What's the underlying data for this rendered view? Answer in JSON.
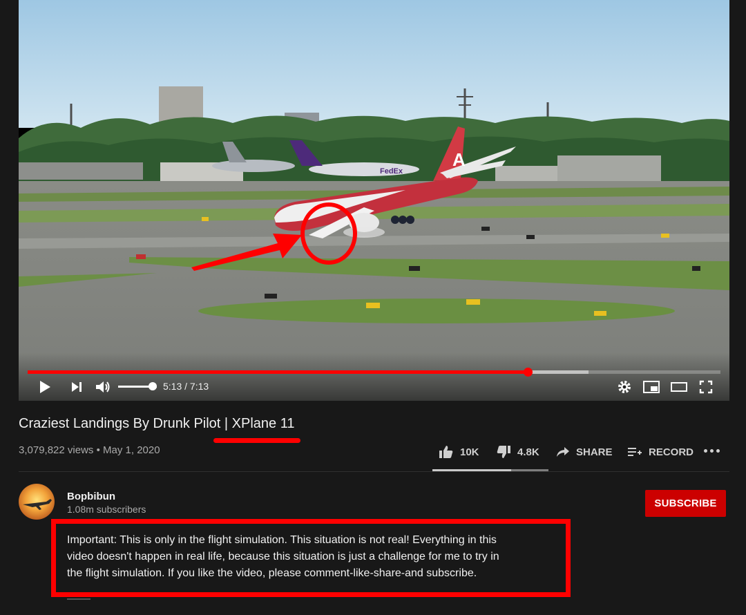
{
  "player": {
    "time_display": "5:13 / 7:13",
    "played_fraction": 0.722,
    "buffered_fraction": 0.81,
    "volume_fraction": 1.0,
    "accent_color": "#ff0000",
    "icons": [
      "play-icon",
      "next-icon",
      "volume-icon",
      "settings-icon",
      "miniplayer-icon",
      "theater-icon",
      "fullscreen-icon"
    ],
    "aircraft_tail_logo": "A",
    "background_aircraft_livery": "FedEx"
  },
  "video": {
    "title": "Craziest Landings By Drunk Pilot | XPlane 11",
    "views": "3,079,822 views",
    "separator": "•",
    "date": "May 1, 2020"
  },
  "actions": {
    "like_count": "10K",
    "dislike_count": "4.8K",
    "share_label": "SHARE",
    "record_label": "RECORD",
    "like_ratio": 0.676
  },
  "channel": {
    "name": "Bopbibun",
    "subscribers": "1.08m subscribers",
    "subscribe_label": "SUBSCRIBE",
    "subscribe_color": "#cc0000"
  },
  "description": {
    "lines": [
      "Important: This is only in the flight simulation. This situation is not real! Everything in this",
      "video doesn't happen in real life, because this situation is just a challenge for me to try in",
      "the flight simulation. If you like the video, please comment-like-share-and subscribe."
    ]
  },
  "annotations": {
    "highlight_color": "#ff0000"
  }
}
